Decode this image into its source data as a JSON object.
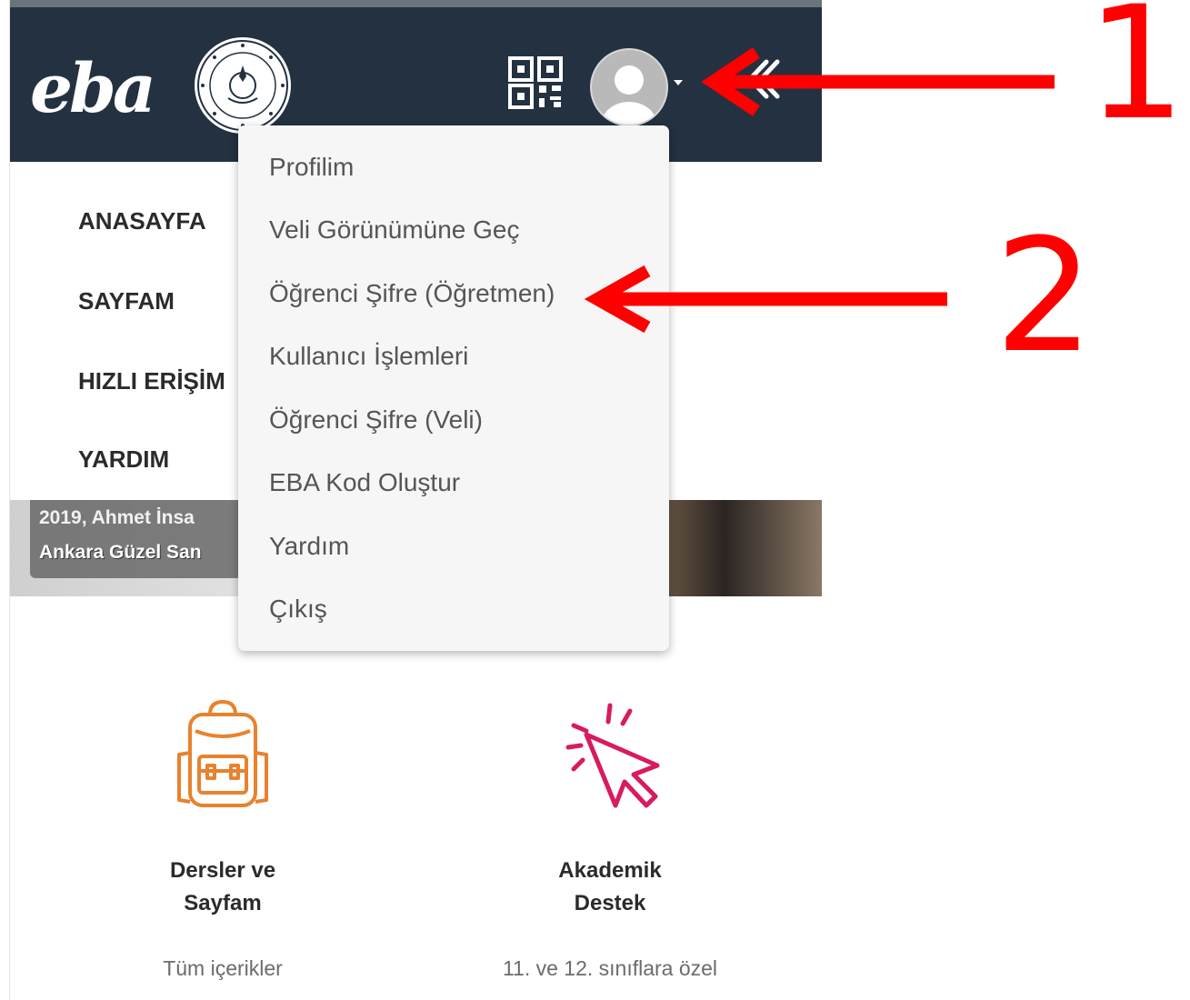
{
  "header": {
    "logo_text": "eba"
  },
  "nav": {
    "items": [
      {
        "label": "ANASAYFA"
      },
      {
        "label": "SAYFAM"
      },
      {
        "label": "HIZLI ERİŞİM"
      },
      {
        "label": "YARDIM"
      }
    ]
  },
  "banner": {
    "line1": "2019, Ahmet İnsa",
    "line2": "Ankara Güzel San"
  },
  "profile_menu": {
    "items": [
      {
        "label": "Profilim"
      },
      {
        "label": "Veli Görünümüne Geç"
      },
      {
        "label": "Öğrenci Şifre (Öğretmen)"
      },
      {
        "label": "Kullanıcı İşlemleri"
      },
      {
        "label": "Öğrenci Şifre (Veli)"
      },
      {
        "label": "EBA Kod Oluştur"
      },
      {
        "label": "Yardım"
      },
      {
        "label": "Çıkış"
      }
    ]
  },
  "cards": [
    {
      "title_line1": "Dersler ve",
      "title_line2": "Sayfam",
      "subtitle": "Tüm içerikler",
      "icon": "backpack-icon",
      "color": "#e8822e"
    },
    {
      "title_line1": "Akademik",
      "title_line2": "Destek",
      "subtitle": "11. ve 12. sınıflara özel",
      "icon": "cursor-click-icon",
      "color": "#d81b60"
    }
  ],
  "annotations": {
    "marker_1": "1",
    "marker_2": "2",
    "color": "#ff0000"
  }
}
